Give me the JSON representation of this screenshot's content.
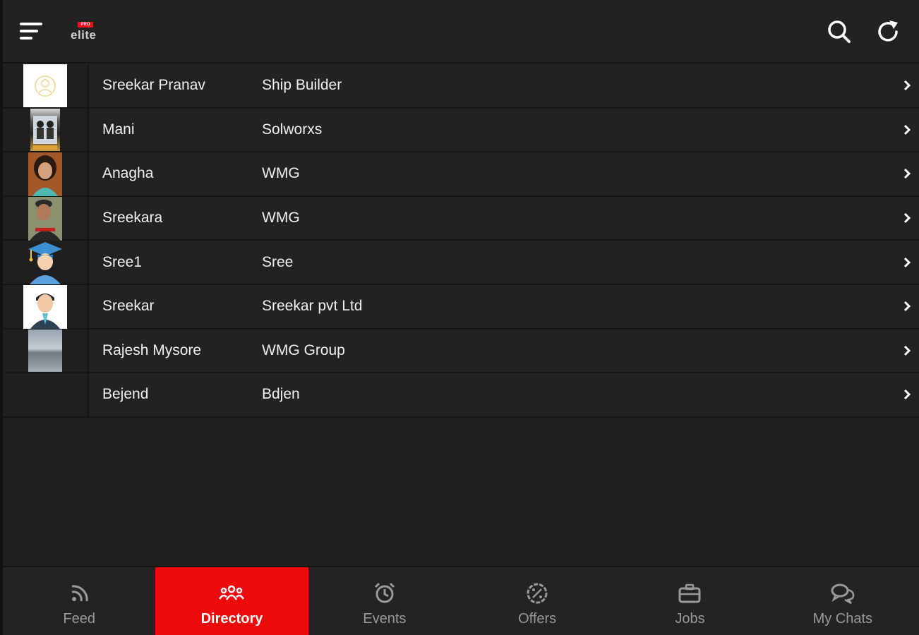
{
  "header": {
    "logo_badge": "PRO",
    "logo_text": "elite",
    "menu_icon": "hamburger-menu-icon",
    "search_icon": "search-icon",
    "refresh_icon": "refresh-icon"
  },
  "directory": {
    "rows": [
      {
        "name": "Sreekar Pranav",
        "company": "Ship Builder",
        "avatar": "placeholder-avatar"
      },
      {
        "name": "Mani",
        "company": "Solworxs",
        "avatar": "photo-avatar"
      },
      {
        "name": "Anagha",
        "company": "WMG",
        "avatar": "photo-avatar"
      },
      {
        "name": "Sreekara",
        "company": "WMG",
        "avatar": "photo-avatar"
      },
      {
        "name": "Sree1",
        "company": "Sree",
        "avatar": "graduate-avatar"
      },
      {
        "name": "Sreekar",
        "company": "Sreekar pvt Ltd",
        "avatar": "businessman-avatar"
      },
      {
        "name": "Rajesh Mysore",
        "company": "WMG Group",
        "avatar": "photo-avatar"
      },
      {
        "name": "Bejend",
        "company": "Bdjen",
        "avatar": "none"
      }
    ]
  },
  "nav": {
    "items": [
      {
        "label": "Feed",
        "icon": "rss-icon",
        "active": false
      },
      {
        "label": "Directory",
        "icon": "people-icon",
        "active": true
      },
      {
        "label": "Events",
        "icon": "alarm-clock-icon",
        "active": false
      },
      {
        "label": "Offers",
        "icon": "percent-badge-icon",
        "active": false
      },
      {
        "label": "Jobs",
        "icon": "briefcase-icon",
        "active": false
      },
      {
        "label": "My Chats",
        "icon": "chat-bubbles-icon",
        "active": false
      }
    ]
  },
  "colors": {
    "accent": "#ee0a0a",
    "background": "#1f1f1f",
    "row": "#222222",
    "text": "#f0f0f0",
    "muted": "#9a9a9a"
  }
}
